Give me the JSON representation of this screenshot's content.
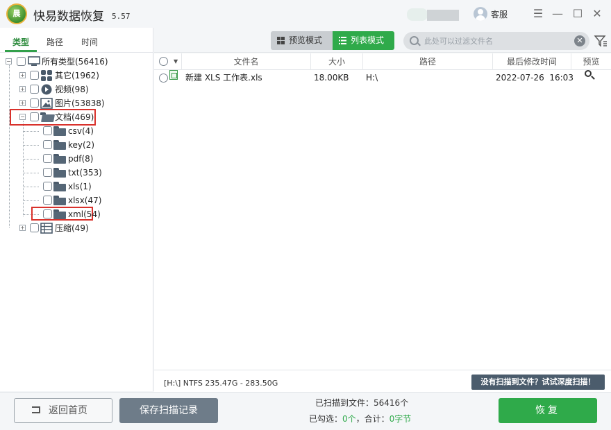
{
  "app": {
    "logo_text": "晨",
    "title": "快易数据恢复",
    "version": "5.57",
    "service_label": "客服"
  },
  "window_controls": {
    "menu": "☰",
    "minimize": "—",
    "maximize": "☐",
    "close": "✕"
  },
  "left_tabs": [
    "类型",
    "路径",
    "时间"
  ],
  "active_tab": "类型",
  "tree": {
    "root": "所有类型(56416)",
    "items": [
      {
        "label": "其它(1962)",
        "icon": "grid-icon"
      },
      {
        "label": "视频(98)",
        "icon": "video-icon"
      },
      {
        "label": "图片(53838)",
        "icon": "image-icon"
      },
      {
        "label": "文档(469)",
        "icon": "folder-icon",
        "expanded": true,
        "children": [
          "csv(4)",
          "key(2)",
          "pdf(8)",
          "txt(353)",
          "xls(1)",
          "xlsx(47)",
          "xml(54)"
        ]
      },
      {
        "label": "压缩(49)",
        "icon": "archive-icon"
      }
    ]
  },
  "toolbar": {
    "preview_mode": "预览模式",
    "list_mode": "列表模式",
    "active_mode": "列表模式",
    "search_placeholder": "此处可以过滤文件名"
  },
  "file_list": {
    "columns": [
      "文件名",
      "大小",
      "路径",
      "最后修改时间",
      "预览"
    ],
    "rows": [
      {
        "name": "新建 XLS 工作表.xls",
        "size": "18.00KB",
        "path": "H:\\",
        "modified": "2022-07-26  16:03"
      }
    ]
  },
  "status": {
    "drive_info": "[H:\\] NTFS 235.47G - 283.50G",
    "deep_scan": "没有扫描到文件？试试深度扫描！"
  },
  "bottom": {
    "home_button": "返回首页",
    "save_button": "保存扫描记录",
    "scanned_label": "已扫描到文件：",
    "scanned_count": "56416个",
    "selected_label": "已勾选：",
    "selected_count": "0个",
    "total_label": "，合计：",
    "total_size": "0字节",
    "recover_button": "恢复"
  },
  "colors": {
    "accent_green": "#2faa4a",
    "highlight_red": "#d9312b"
  }
}
